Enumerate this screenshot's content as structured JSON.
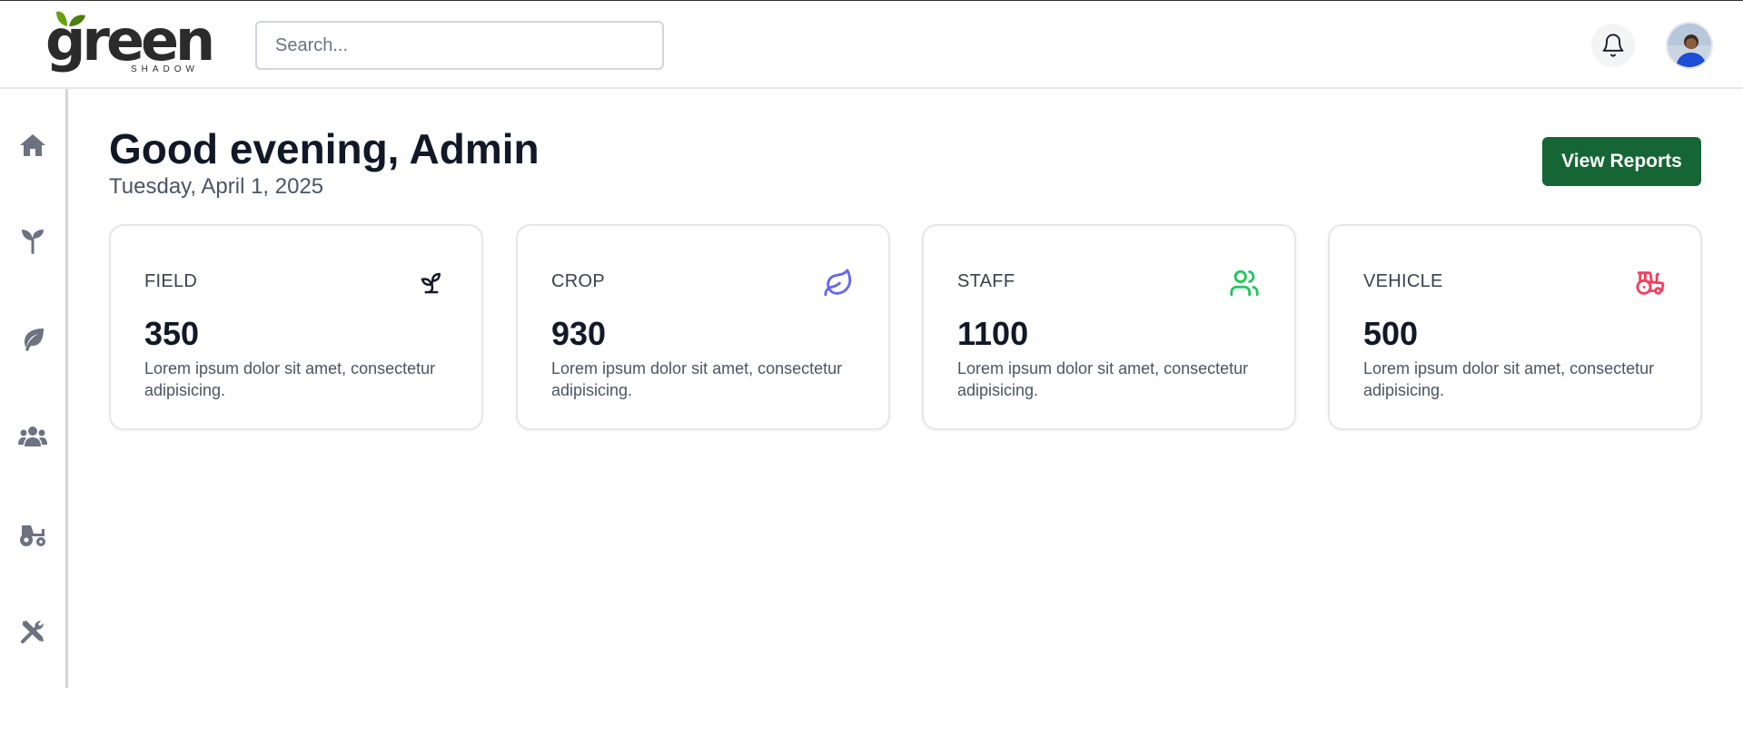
{
  "header": {
    "logo_text": "green",
    "logo_subtext": "SHADOW",
    "search_placeholder": "Search..."
  },
  "sidebar": {
    "items": [
      {
        "icon": "home-icon"
      },
      {
        "icon": "seedling-icon"
      },
      {
        "icon": "leaf-icon"
      },
      {
        "icon": "users-icon"
      },
      {
        "icon": "tractor-icon"
      },
      {
        "icon": "tools-icon"
      }
    ]
  },
  "main": {
    "greeting": "Good evening, Admin",
    "date": "Tuesday, April 1, 2025",
    "view_reports_label": "View Reports",
    "cards": [
      {
        "title": "FIELD",
        "value": "350",
        "desc": "Lorem ipsum dolor sit amet, consectetur adipisicing.",
        "icon": "sprout-icon",
        "color": "#111827"
      },
      {
        "title": "CROP",
        "value": "930",
        "desc": "Lorem ipsum dolor sit amet, consectetur adipisicing.",
        "icon": "leaf-icon",
        "color": "#6366f1"
      },
      {
        "title": "STAFF",
        "value": "1100",
        "desc": "Lorem ipsum dolor sit amet, consectetur adipisicing.",
        "icon": "users-icon",
        "color": "#22c55e"
      },
      {
        "title": "VEHICLE",
        "value": "500",
        "desc": "Lorem ipsum dolor sit amet, consectetur adipisicing.",
        "icon": "tractor-icon",
        "color": "#f43f5e"
      }
    ]
  },
  "colors": {
    "primary_button": "#166534",
    "sidebar_icon": "#6b7280"
  }
}
